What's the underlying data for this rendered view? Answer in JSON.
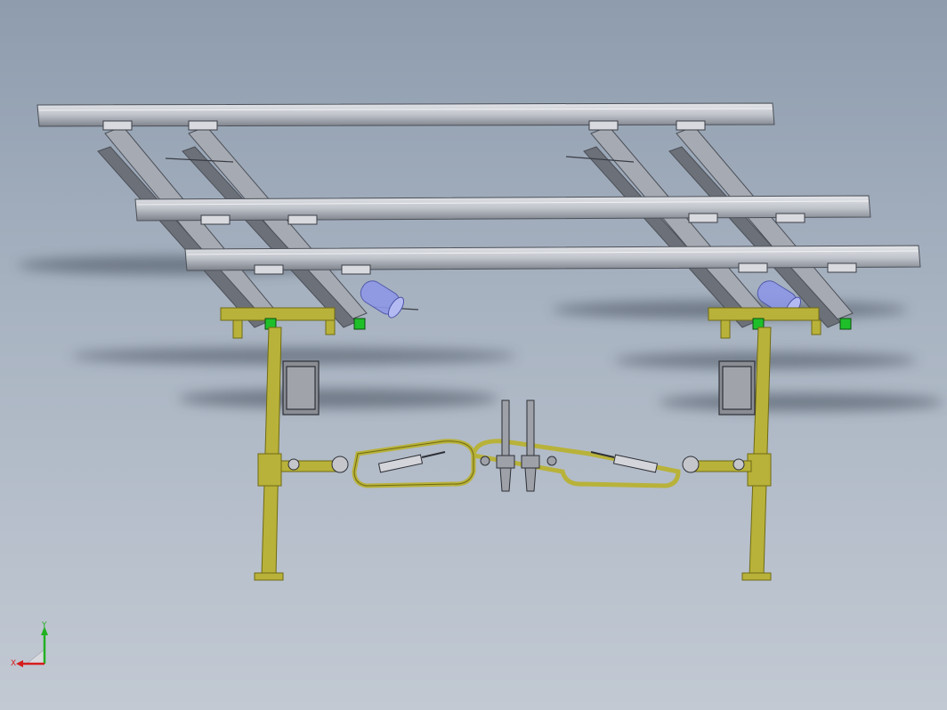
{
  "viewport": {
    "background_top": "#8e9cae",
    "background_bottom": "#c2c9d3"
  },
  "colors": {
    "beam": "#c9ccd2",
    "beam_dark": "#6c7078",
    "rail": "#a6aab2",
    "frame": "#b8b23a",
    "frame_dark": "#6f6a14",
    "marker": "#1fbf2a",
    "cylinder": "#8e98e6",
    "triad_x": "#d61c1c",
    "triad_y": "#22b022",
    "triad_z": "#3a3ad6"
  },
  "triad": {
    "x_label": "X",
    "y_label": "Y"
  }
}
